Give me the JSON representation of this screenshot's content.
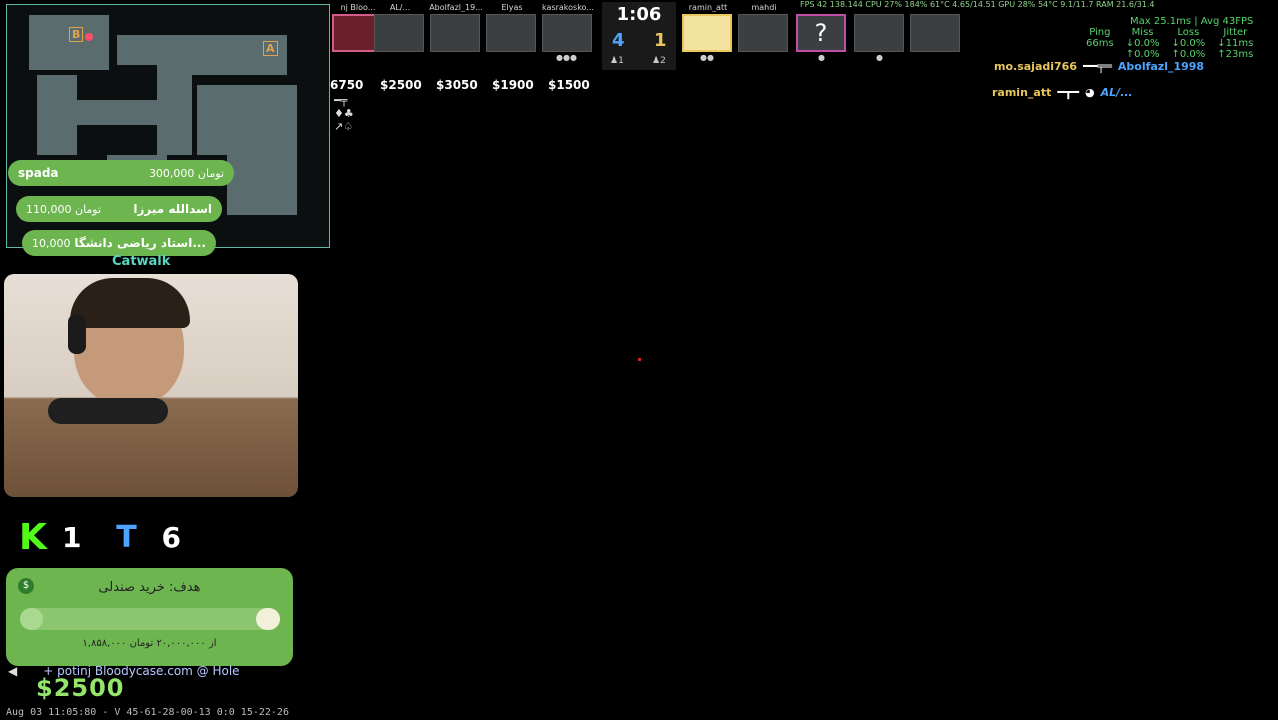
{
  "minimap": {
    "site_a": "A",
    "site_b": "B",
    "location": "Catwalk"
  },
  "donations": [
    {
      "name": "spada",
      "amount": "300,000 تومان"
    },
    {
      "name": "اسدالله میرزا",
      "amount": "110,000 تومان"
    },
    {
      "name": "استاد ریاضی دانشگا...",
      "amount": "10,000"
    }
  ],
  "stats": {
    "kills": "1",
    "deaths": "6"
  },
  "goal": {
    "title": "هدف: خرید صندلی",
    "progress_text": "۱,۸۵۸,۰۰۰ از ۲۰,۰۰۰,۰۰۰ تومان",
    "progress": 0.09
  },
  "chat": {
    "text": "+ potinj Bloodycase.com @ Hole"
  },
  "hud": {
    "money": "$2500",
    "timestamp": "Aug 03 11:05:80 - V 45-61-28-00-13 0:0 15-22-26"
  },
  "scoreboard": {
    "left_team": [
      {
        "name": "nj Bloo...",
        "money": "6750"
      },
      {
        "name": "AL/...",
        "money": "$2500"
      },
      {
        "name": "Abolfazl_19...",
        "money": "$3050"
      },
      {
        "name": "Elyas",
        "money": "$1900"
      },
      {
        "name": "kasrakosko...",
        "money": "$1500"
      }
    ],
    "right_team": [
      {
        "name": "ramin_att"
      },
      {
        "name": "mahdi"
      },
      {
        "name": "?"
      },
      {
        "name": ""
      },
      {
        "name": ""
      }
    ],
    "timer": "1:06",
    "score_ct": "4",
    "score_t": "1",
    "alive_ct": "1",
    "alive_t": "2"
  },
  "killfeed": [
    {
      "killer": "mo.sajadi766",
      "victim": "Abolfazl_1998"
    },
    {
      "killer": "ramin_att",
      "victim": "AL/..."
    }
  ],
  "netstats": {
    "header": "Max 25.1ms | Avg 43FPS",
    "columns": [
      "Ping",
      "Miss",
      "Loss",
      "Jitter"
    ],
    "values": [
      "66ms",
      "↓0.0%",
      "↓0.0%",
      "↓11ms"
    ],
    "values2": [
      "",
      "↑0.0%",
      "↑0.0%",
      "↑23ms"
    ]
  },
  "perf": "FPS 42   138.144   CPU 27% 184%   61°C   4.65/14.51   GPU 28%   54°C   9.1/11.7   RAM 21.6/31.4",
  "colors": {
    "donation_green": "#6db54f",
    "ct_blue": "#4ea4ff",
    "t_gold": "#e9c65b",
    "kill_green": "#1ee043"
  }
}
